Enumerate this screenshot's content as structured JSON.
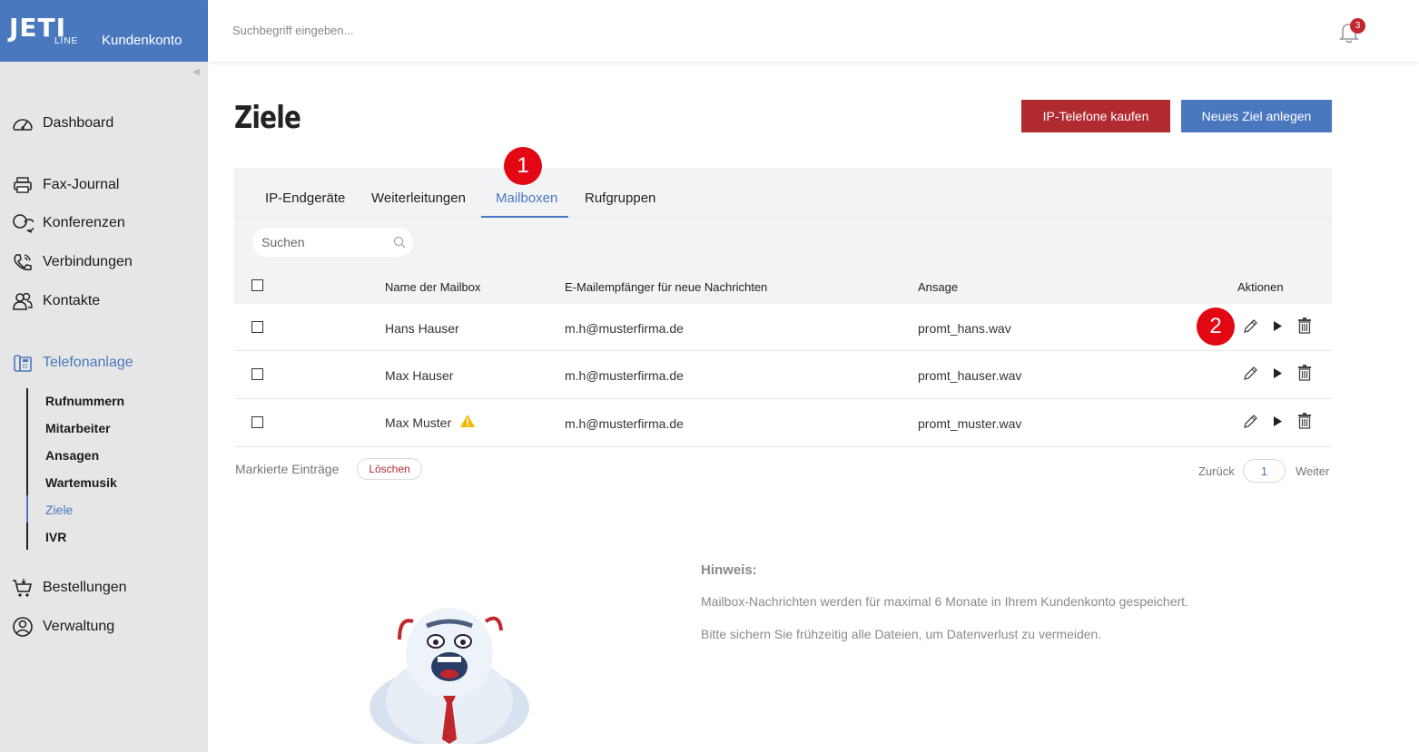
{
  "brand": {
    "logo": "JETI",
    "logo_sub": "LINE",
    "subtitle": "Kundenkonto"
  },
  "topbar": {
    "search_placeholder": "Suchbegriff eingeben...",
    "notification_count": "3"
  },
  "sidebar": {
    "items": [
      {
        "label": "Dashboard",
        "icon": "gauge-icon"
      },
      {
        "label": "Fax-Journal",
        "icon": "printer-icon"
      },
      {
        "label": "Konferenzen",
        "icon": "chat-icon"
      },
      {
        "label": "Verbindungen",
        "icon": "phone-icon"
      },
      {
        "label": "Kontakte",
        "icon": "contacts-icon"
      },
      {
        "label": "Telefonanlage",
        "icon": "desk-phone-icon",
        "active": true
      },
      {
        "label": "Bestellungen",
        "icon": "cart-icon"
      },
      {
        "label": "Verwaltung",
        "icon": "user-circle-icon"
      }
    ],
    "subitems": [
      {
        "label": "Rufnummern"
      },
      {
        "label": "Mitarbeiter"
      },
      {
        "label": "Ansagen"
      },
      {
        "label": "Wartemusik"
      },
      {
        "label": "Ziele",
        "active": true
      },
      {
        "label": "IVR"
      }
    ]
  },
  "main": {
    "title": "Ziele",
    "buttons": {
      "buy_phones": "IP-Telefone kaufen",
      "new_target": "Neues Ziel anlegen"
    },
    "tabs": [
      {
        "label": "IP-Endgeräte"
      },
      {
        "label": "Weiterleitungen"
      },
      {
        "label": "Mailboxen",
        "active": true
      },
      {
        "label": "Rufgruppen"
      }
    ],
    "search_placeholder": "Suchen",
    "table": {
      "headers": [
        "Name der Mailbox",
        "E-Mailempfänger für neue Nachrichten",
        "Ansage",
        "Aktionen"
      ],
      "rows": [
        {
          "name": "Hans Hauser",
          "email": "m.h@musterfirma.de",
          "prompt": "promt_hans.wav",
          "warning": false
        },
        {
          "name": "Max Hauser",
          "email": "m.h@musterfirma.de",
          "prompt": "promt_hauser.wav",
          "warning": false
        },
        {
          "name": "Max Muster",
          "email": "m.h@musterfirma.de",
          "prompt": "promt_muster.wav",
          "warning": true
        }
      ]
    },
    "footer": {
      "marked_label": "Markierte Einträge",
      "delete_label": "Löschen",
      "prev": "Zurück",
      "page": "1",
      "next": "Weiter"
    },
    "hint": {
      "title": "Hinweis:",
      "line1": "Mailbox-Nachrichten werden für maximal 6 Monate in Ihrem Kundenkonto gespeichert.",
      "line2": "Bitte sichern Sie frühzeitig alle Dateien, um Datenverlust zu vermeiden."
    },
    "annotations": [
      "1",
      "2"
    ]
  },
  "colors": {
    "brand_blue": "#4a78bf",
    "brand_red": "#b12a2f",
    "annotation_red": "#e30613"
  }
}
